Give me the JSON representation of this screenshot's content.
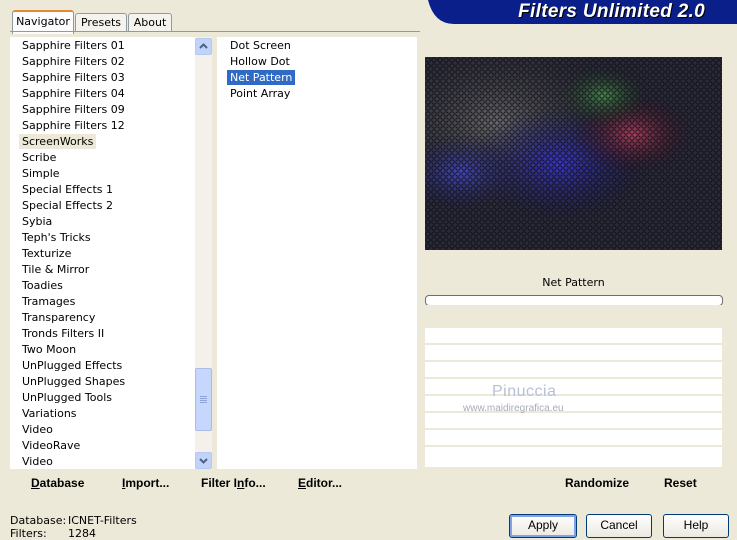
{
  "banner": {
    "title": "Filters Unlimited 2.0"
  },
  "tabs": [
    {
      "label": "Navigator"
    },
    {
      "label": "Presets"
    },
    {
      "label": "About"
    }
  ],
  "categories": [
    "Sapphire Filters 01",
    "Sapphire Filters 02",
    "Sapphire Filters 03",
    "Sapphire Filters 04",
    "Sapphire Filters 09",
    "Sapphire Filters 12",
    "ScreenWorks",
    "Scribe",
    "Simple",
    "Special Effects 1",
    "Special Effects 2",
    "Sybia",
    "Teph's Tricks",
    "Texturize",
    "Tile & Mirror",
    "Toadies",
    "Tramages",
    "Transparency",
    "Tronds Filters II",
    "Two Moon",
    "UnPlugged Effects",
    "UnPlugged Shapes",
    "UnPlugged Tools",
    "Variations",
    "Video",
    "VideoRave",
    "Video"
  ],
  "selected_category": "ScreenWorks",
  "filters": [
    "Dot Screen",
    "Hollow Dot",
    "Net Pattern",
    "Point Array"
  ],
  "selected_filter": "Net Pattern",
  "scroll": {
    "up_icon": "chevron-up-icon",
    "down_icon": "chevron-down-icon",
    "position_fraction": 0.83
  },
  "toolbar": {
    "database": "Database",
    "import": "Import...",
    "filter_info": "Filter Info...",
    "editor": "Editor...",
    "randomize": "Randomize",
    "reset": "Reset"
  },
  "preview": {
    "filter_name": "Net Pattern",
    "progress": 0,
    "watermark_name": "Pinuccia",
    "watermark_url": "www.maidiregrafica.eu"
  },
  "status": {
    "database_label": "Database:",
    "database_value": "ICNET-Filters",
    "filters_label": "Filters:",
    "filters_value": "1284"
  },
  "buttons": {
    "apply": "Apply",
    "cancel": "Cancel",
    "help": "Help"
  },
  "colors": {
    "banner": "#0a1f8a",
    "selection": "#316ac5",
    "background": "#ece9d8",
    "tab_accent": "#e68b2c"
  }
}
